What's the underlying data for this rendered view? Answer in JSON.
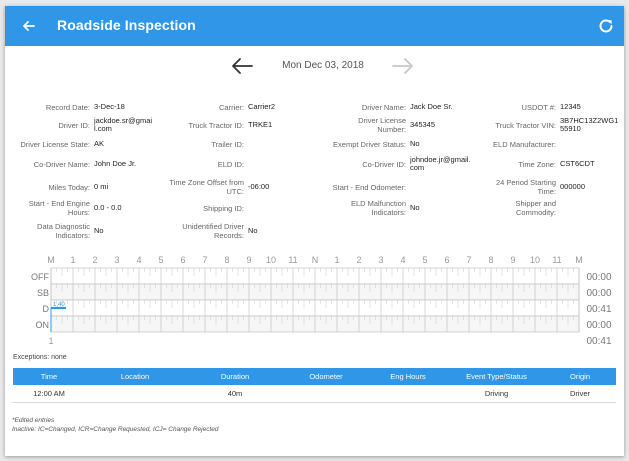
{
  "appbar": {
    "title": "Roadside Inspection",
    "back_icon": "arrow-left-icon",
    "refresh_icon": "refresh-icon",
    "color": "#2f96e8"
  },
  "datenav": {
    "date": "Mon Dec 03, 2018"
  },
  "fields": [
    [
      {
        "label": "Record Date:",
        "value": "3-Dec-18"
      },
      {
        "label": "Carrier:",
        "value": "Carrier2"
      },
      {
        "label": "Driver Name:",
        "value": "Jack Doe Sr."
      },
      {
        "label": "USDOT #:",
        "value": "12345"
      }
    ],
    [
      {
        "label": "Driver ID:",
        "value": "jackdoe.sr@gmail.com"
      },
      {
        "label": "Truck Tractor ID:",
        "value": "TRKE1"
      },
      {
        "label": "Driver License Number:",
        "value": "345345"
      },
      {
        "label": "Truck Tractor VIN:",
        "value": "3B7HC13Z2WG155910"
      }
    ],
    [
      {
        "label": "Driver License State:",
        "value": "AK"
      },
      {
        "label": "Trailer ID:",
        "value": ""
      },
      {
        "label": "Exempt Driver Status:",
        "value": "No"
      },
      {
        "label": "ELD Manufacturer:",
        "value": ""
      }
    ],
    [
      {
        "label": "Co-Driver Name:",
        "value": "John Doe Jr."
      },
      {
        "label": "ELD ID:",
        "value": ""
      },
      {
        "label": "Co-Driver ID:",
        "value": "johndoe.jr@gmail.com"
      },
      {
        "label": "Time Zone:",
        "value": "CST6CDT"
      }
    ],
    [
      {
        "label": "Miles Today:",
        "value": "0 mi"
      },
      {
        "label": "Time Zone Offset from UTC:",
        "value": "-06:00"
      },
      {
        "label": "Start - End Odometer:",
        "value": ""
      },
      {
        "label": "24 Period Starting Time:",
        "value": "000000"
      }
    ],
    [
      {
        "label": "Start - End Engine Hours:",
        "value": "0.0 - 0.0"
      },
      {
        "label": "Shipping ID:",
        "value": ""
      },
      {
        "label": "ELD Malfunction Indicators:",
        "value": "No"
      },
      {
        "label": "Shipper and Commodity:",
        "value": ""
      }
    ],
    [
      {
        "label": "Data Diagnostic Indicators:",
        "value": "No"
      },
      {
        "label": "Unidentified Driver Records:",
        "value": "No"
      },
      {
        "label": "",
        "value": ""
      },
      {
        "label": "",
        "value": ""
      }
    ]
  ],
  "graph": {
    "hour_labels": [
      "M",
      "1",
      "2",
      "3",
      "4",
      "5",
      "6",
      "7",
      "8",
      "9",
      "10",
      "11",
      "N",
      "1",
      "2",
      "3",
      "4",
      "5",
      "6",
      "7",
      "8",
      "9",
      "10",
      "11",
      "M"
    ],
    "statuses": [
      "OFF",
      "SB",
      "D",
      "ON"
    ],
    "totals": [
      "00:00",
      "00:00",
      "00:41",
      "00:00"
    ],
    "grand_total": "00:41",
    "bottom_left_label": "1",
    "event_marker": "1,40",
    "driving_segment": {
      "status": "D",
      "start_hour": 0,
      "end_hour": 0.683
    },
    "line_color": "#2f96e8"
  },
  "exceptions": "Exceptions: none",
  "table": {
    "headers": [
      "Time",
      "Location",
      "Duration",
      "Odometer",
      "Eng Hours",
      "Event Type/Status",
      "Origin"
    ],
    "rows": [
      [
        "12:00 AM",
        "",
        "40m",
        "",
        "",
        "Driving",
        "Driver"
      ]
    ]
  },
  "notes": [
    "*Edited entries",
    "Inactive: IC=Changed, ICR=Change Requested, ICJ= Change Rejected"
  ]
}
